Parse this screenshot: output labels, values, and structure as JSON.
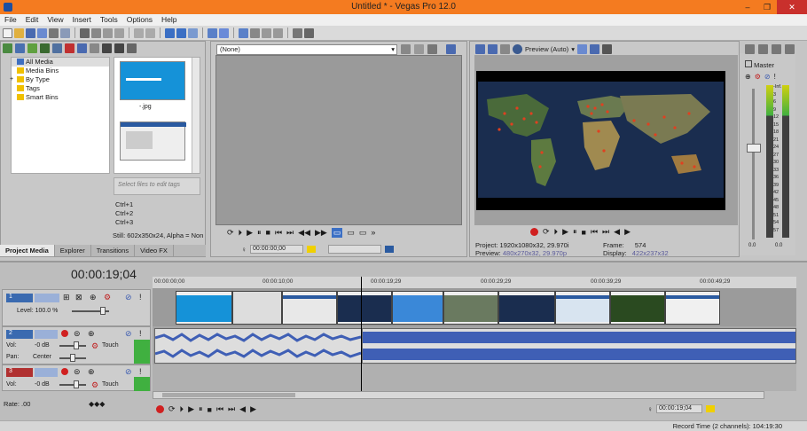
{
  "window": {
    "title": "Untitled * - Vegas Pro 12.0",
    "minimize": "–",
    "maximize": "❐",
    "close": "✕"
  },
  "menu": [
    "File",
    "Edit",
    "View",
    "Insert",
    "Tools",
    "Options",
    "Help"
  ],
  "media_tree": [
    "All Media",
    "Media Bins",
    "By Type",
    "Tags",
    "Smart Bins"
  ],
  "media_tree_expand": "+",
  "thumbnail_label": "-.jpg",
  "tag_placeholder": "Select files to edit tags",
  "shortcuts": [
    "Ctrl+1",
    "Ctrl+2",
    "Ctrl+3"
  ],
  "still_info": "Still: 602x350x24, Alpha = Non",
  "tabs": [
    "Project Media",
    "Explorer",
    "Transitions",
    "Video FX"
  ],
  "fx_dropdown": "(None)",
  "fx_timecode": "00:00:00;00",
  "preview_mode": "Preview (Auto)",
  "preview_info": {
    "project_label": "Project:",
    "project": "1920x1080x32, 29.970i",
    "preview_label": "Preview:",
    "preview": "480x270x32, 29.970p",
    "frame_label": "Frame:",
    "frame": "574",
    "display_label": "Display:",
    "display": "422x237x32"
  },
  "master_label": "Master",
  "meter_scale": [
    "-Inf.",
    "3",
    "6",
    "9",
    "12",
    "15",
    "18",
    "21",
    "24",
    "27",
    "30",
    "33",
    "36",
    "39",
    "42",
    "45",
    "48",
    "51",
    "54",
    "57"
  ],
  "meter_bottom": [
    "0.0",
    "0.0"
  ],
  "timeline_timecode": "00:00:19;04",
  "ruler_marks": [
    "00:00:00;00",
    "00:00:10;00",
    "00:00:19;29",
    "00:00:29;29",
    "00:00:39;29",
    "00:00:49;29"
  ],
  "video_track": {
    "number": "1",
    "level": "Level: 100.0 %"
  },
  "audio_tracks": [
    {
      "number": "2",
      "vol": "Vol:",
      "vol_value": "-0 dB",
      "pan": "Pan:",
      "pan_value": "Center",
      "mode": "Touch"
    },
    {
      "number": "3",
      "vol": "Vol:",
      "vol_value": "-0 dB",
      "mode": "Touch"
    }
  ],
  "rate": "Rate: .00",
  "transport_timecode": "00:00:19;04",
  "status": "Record Time (2 channels): 104:19:30",
  "colors": {
    "title_bar": "#f47b20",
    "wave": "#3f5fb5",
    "selection": "#3b6fc4"
  }
}
